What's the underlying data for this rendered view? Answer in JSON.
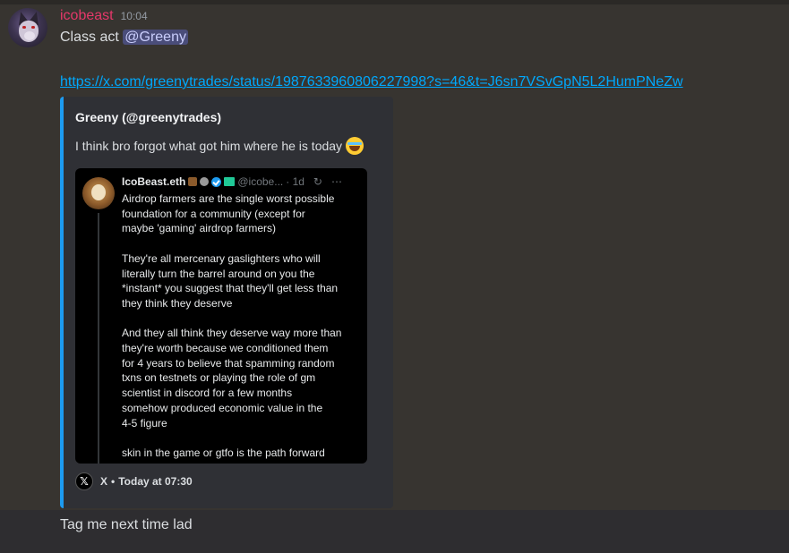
{
  "message": {
    "username": "icobeast",
    "timestamp": "10:04",
    "text_prefix": "Class act ",
    "mention": "@Greeny",
    "link": "https://x.com/greenytrades/status/1987633960806227998?s=46&t=J6sn7VSvGpN5L2HumPNeZw"
  },
  "embed": {
    "author": "Greeny (@greenytrades)",
    "description": "I think bro forgot what got him where he is today",
    "emoji": "joy-emoji",
    "accent_color": "#1d9bf0",
    "footer_icon": "x-icon",
    "footer_provider": "X",
    "footer_separator": "•",
    "footer_time": "Today at 07:30",
    "tweet": {
      "name": "IcoBeast.eth",
      "handle": "@icobe...",
      "age": "· 1d",
      "lines": [
        "Airdrop farmers are the single worst possible",
        "foundation for a community (except for",
        "maybe 'gaming' airdrop farmers)",
        "",
        "They're all mercenary gaslighters who will",
        "literally turn the barrel around on you the",
        "*instant* you suggest that they'll get less than",
        "they think they deserve",
        "",
        "And they all think they deserve way more than",
        "they're worth because we conditioned them",
        "for 4 years to believe that spamming random",
        "txns on testnets or playing the role of gm",
        "scientist in discord for a few months",
        "somehow produced economic value in the",
        "4-5 figure",
        "",
        "skin in the game or gtfo is the path forward"
      ]
    }
  },
  "next_message": {
    "text": "Tag me next time lad"
  },
  "colors": {
    "username": "#e5386a",
    "link": "#00a8fc",
    "mention_bg": "#4a4d7a",
    "background": "#36332f"
  }
}
